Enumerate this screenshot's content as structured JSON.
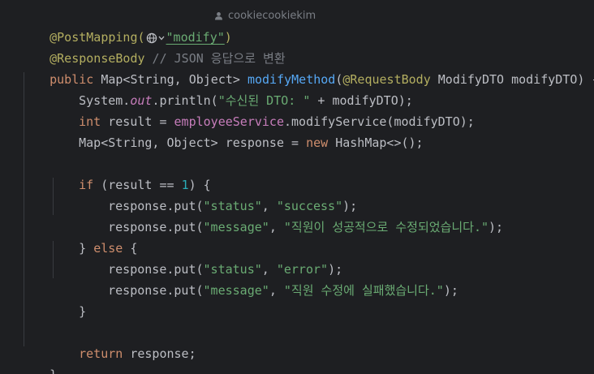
{
  "code": {
    "l1_ann": "@PostMapping(",
    "l1_str": "\"modify\"",
    "l1_close": ")",
    "author": "cookiecookiekim",
    "l2_ann": "@ResponseBody",
    "l2_cmt": " // JSON 응답으로 변환",
    "l3_kw": "public ",
    "l3_type": "Map<String, Object> ",
    "l3_fn": "modifyMethod",
    "l3_open": "(",
    "l3_ann": "@RequestBody",
    "l3_params": " ModifyDTO modifyDTO) {",
    "l4_a": "System.",
    "l4_field": "out",
    "l4_b": ".println(",
    "l4_str": "\"수신된 DTO: \"",
    "l4_c": " + modifyDTO);",
    "l5_kw": "int ",
    "l5_a": "result = ",
    "l5_field": "employeeService",
    "l5_b": ".modifyService(modifyDTO);",
    "l6_a": "Map<String, Object> response = ",
    "l6_kw": "new ",
    "l6_b": "HashMap<>();",
    "l8_kw": "if ",
    "l8_a": "(result == ",
    "l8_num": "1",
    "l8_b": ") {",
    "l9_a": "response.put(",
    "l9_str1": "\"status\"",
    "l9_sep": ", ",
    "l9_str2": "\"success\"",
    "l9_b": ");",
    "l10_a": "response.put(",
    "l10_str1": "\"message\"",
    "l10_sep": ", ",
    "l10_str2": "\"직원이 성공적으로 수정되었습니다.\"",
    "l10_b": ");",
    "l11_a": "} ",
    "l11_kw": "else",
    "l11_b": " {",
    "l12_a": "response.put(",
    "l12_str1": "\"status\"",
    "l12_sep": ", ",
    "l12_str2": "\"error\"",
    "l12_b": ");",
    "l13_a": "response.put(",
    "l13_str1": "\"message\"",
    "l13_sep": ", ",
    "l13_str2": "\"직원 수정에 실패했습니다.\"",
    "l13_b": ");",
    "l14": "}",
    "l16_kw": "return ",
    "l16_a": "response;",
    "l17": "}"
  },
  "colors": {
    "background": "#1e1f22",
    "annotation": "#b3ae60",
    "keyword": "#cf8e6d",
    "string": "#6aab73",
    "function": "#56a8f5",
    "comment": "#7a7e85",
    "number": "#2aacb8",
    "field": "#c77dbb",
    "text": "#bcbec4"
  },
  "icons": {
    "url_inlay": "globe-icon",
    "url_dropdown": "chevron-down-icon",
    "author": "user-icon"
  }
}
